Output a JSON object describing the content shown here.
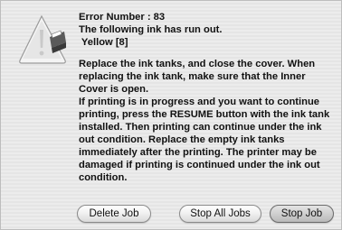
{
  "dialog": {
    "message_lines": [
      "Error Number : 83",
      "The following ink has run out.",
      " Yellow [8]",
      "Replace the ink tanks, and close the cover. When",
      "replacing the ink tank, make sure that the Inner",
      "Cover is open.",
      "If printing is in progress and you want to continue",
      "printing, press the RESUME button with the ink tank",
      "installed. Then printing can continue under the ink",
      "out condition. Replace the empty ink tanks",
      "immediately after the printing. The printer may be",
      "damaged if printing is continued under the ink out",
      "condition."
    ]
  },
  "buttons": {
    "delete_job": "Delete Job",
    "stop_all_jobs": "Stop All Jobs",
    "stop_job": "Stop Job"
  },
  "icons": {
    "alert": "caution-triangle-icon",
    "printer": "printer-icon"
  }
}
